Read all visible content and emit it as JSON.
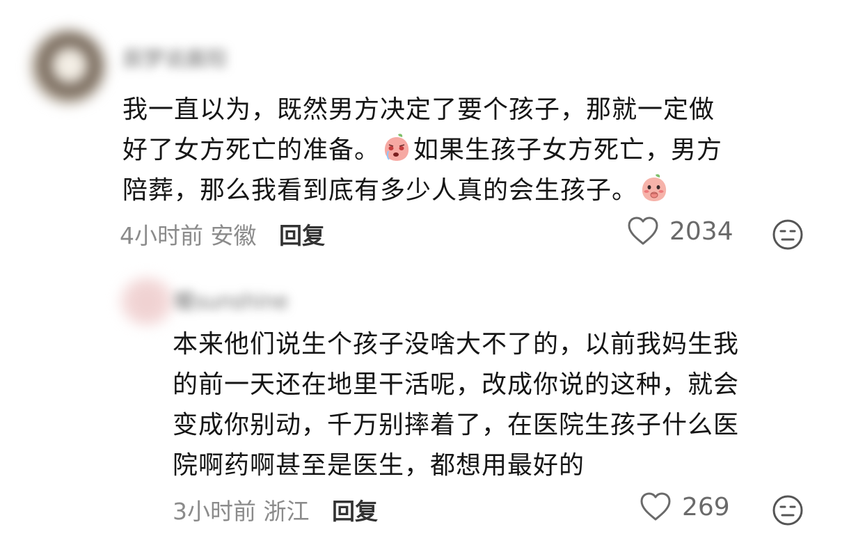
{
  "comments": [
    {
      "username": "辰梦说晨阳",
      "text_line1": "我一直以为，既然男方决定了要个孩子，那就一定做",
      "text_line2a": "好了女方死亡的准备。",
      "text_line2b": "如果生孩子女方死亡，男方",
      "text_line3": "陪葬，那么我看到底有多少人真的会生孩子。",
      "time": "4小时前",
      "location": "安徽",
      "reply_label": "回复",
      "likes": "2034",
      "emoji_icons": [
        "crying-peach-icon",
        "shy-peach-icon"
      ]
    },
    {
      "username": "暖sunshine",
      "text_line1": "本来他们说生个孩子没啥大不了的，以前我妈生我",
      "text_line2": "的前一天还在地里干活呢，改成你说的这种，就会",
      "text_line3": "变成你别动，千万别摔着了，在医院生孩子什么医",
      "text_line4": "院啊药啊甚至是医生，都想用最好的",
      "time": "3小时前",
      "location": "浙江",
      "reply_label": "回复",
      "likes": "269"
    }
  ],
  "colors": {
    "text": "#151515",
    "meta": "#8b8b8b",
    "reply": "#333333",
    "emoji_peach": "#f4a7a0"
  }
}
